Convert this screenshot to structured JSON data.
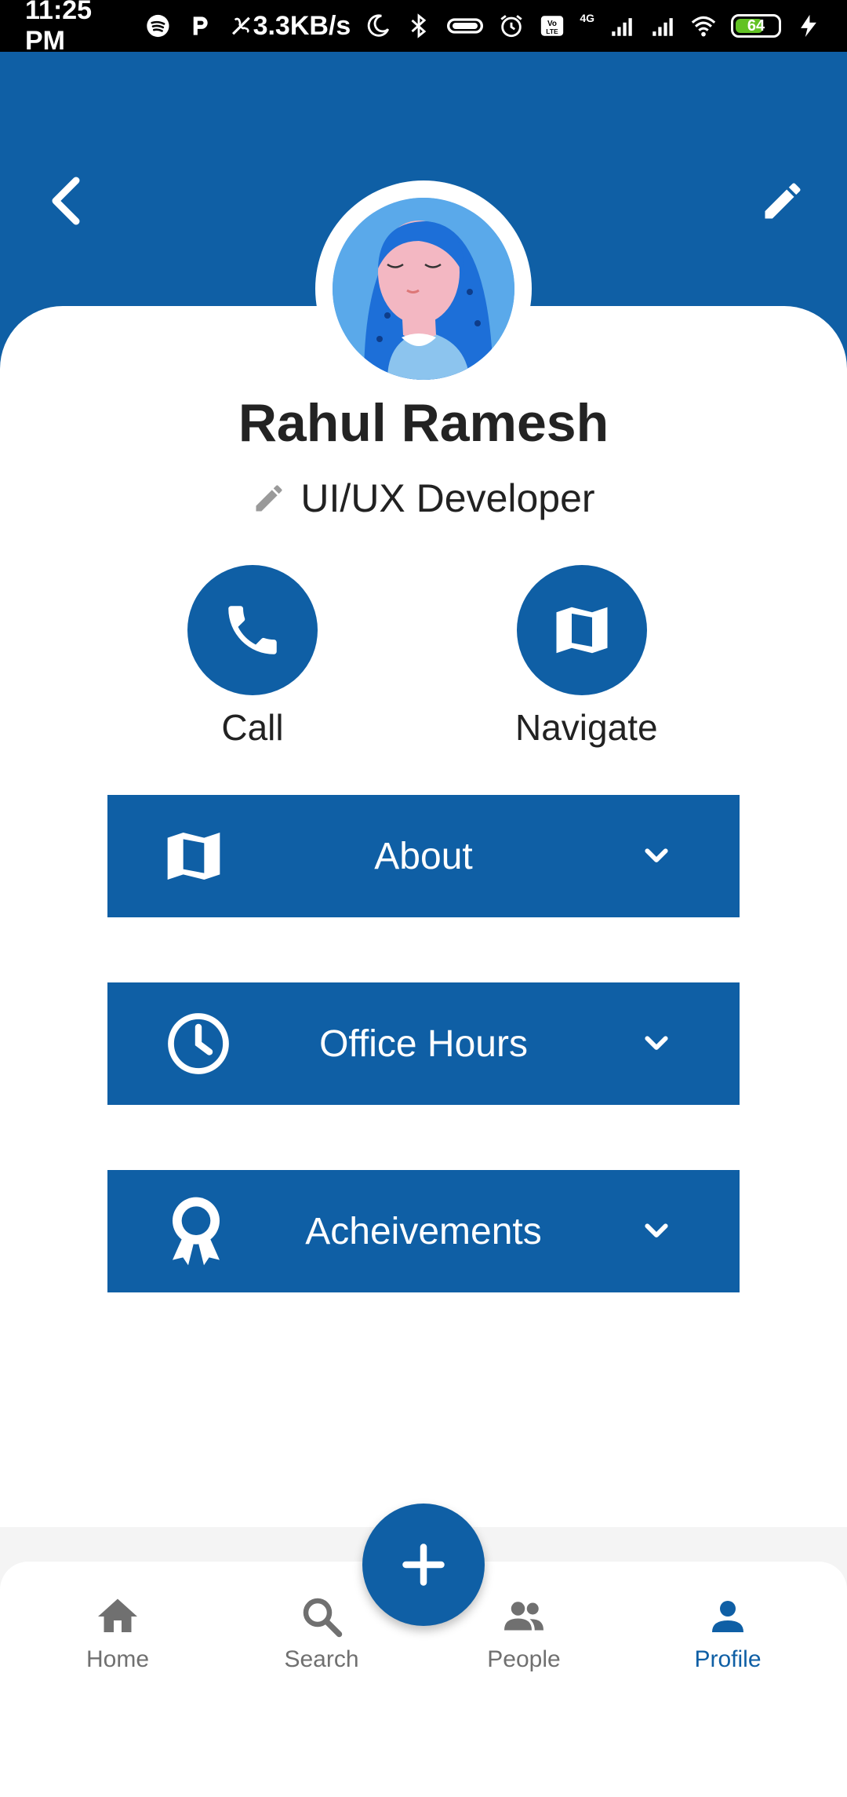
{
  "status_bar": {
    "time": "11:25 PM",
    "net_speed": "3.3KB/s",
    "battery_level": "64",
    "network_label": "4G"
  },
  "header": {
    "back_icon": "chevron-left-icon",
    "edit_icon": "pencil-icon"
  },
  "profile": {
    "name": "Rahul Ramesh",
    "role": "UI/UX Developer"
  },
  "actions": [
    {
      "label": "Call",
      "icon": "phone-icon"
    },
    {
      "label": "Navigate",
      "icon": "map-icon"
    }
  ],
  "sections": [
    {
      "title": "About",
      "icon": "map-icon"
    },
    {
      "title": "Office Hours",
      "icon": "clock-icon"
    },
    {
      "title": "Acheivements",
      "icon": "award-icon"
    }
  ],
  "bottom_nav": {
    "items": [
      {
        "label": "Home",
        "icon": "home-icon"
      },
      {
        "label": "Search",
        "icon": "search-icon"
      },
      {
        "label": "People",
        "icon": "people-icon"
      },
      {
        "label": "Profile",
        "icon": "person-icon",
        "active": true
      }
    ],
    "fab_icon": "plus-icon"
  },
  "colors": {
    "primary": "#0f5fa5",
    "text_dark": "#232323",
    "nav_inactive": "#707070"
  }
}
